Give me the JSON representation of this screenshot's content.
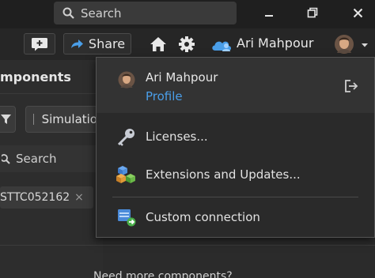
{
  "titlebar": {
    "search_placeholder": "Search",
    "minimize_icon": "minimize-icon",
    "restore_icon": "restore-icon",
    "close_icon": "close-icon"
  },
  "toolbar": {
    "share_label": "Share",
    "user_name": "Ari Mahpour",
    "accent_color": "#4a9ee8"
  },
  "left_panel": {
    "title": "mponents",
    "chip_label": "Simulatio",
    "search_placeholder": "Search",
    "filter_tag": "STTC052162",
    "filter_tag_close": "×",
    "footer_text": "Need more components?"
  },
  "dropdown": {
    "user_name": "Ari Mahpour",
    "profile_label": "Profile",
    "items": [
      {
        "label": "Licenses...",
        "icon": "key-icon"
      },
      {
        "label": "Extensions and Updates...",
        "icon": "extensions-icon"
      },
      {
        "label": "Custom connection",
        "icon": "custom-connection-icon"
      }
    ]
  }
}
